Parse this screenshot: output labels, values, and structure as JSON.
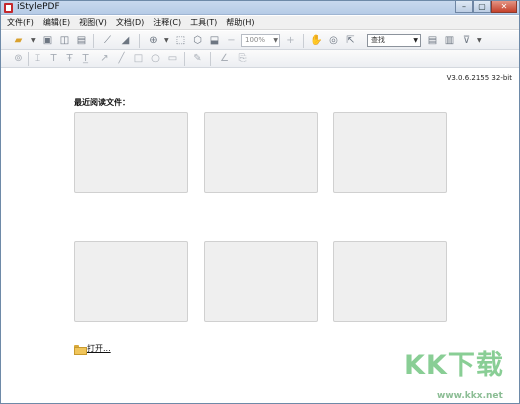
{
  "window": {
    "title": "iStylePDF",
    "controls": {
      "minimize": "–",
      "maximize": "▢",
      "close": "✕"
    }
  },
  "menu": [
    "文件(F)",
    "编辑(E)",
    "视图(V)",
    "文档(D)",
    "注释(C)",
    "工具(T)",
    "帮助(H)"
  ],
  "toolbar": {
    "zoom_value": "100%",
    "search_value": "查找"
  },
  "content": {
    "version": "V3.0.6.2155 32-bit",
    "recent_title": "最近阅读文件：",
    "open_label": "打开..."
  },
  "watermark": {
    "logo": "KK下载",
    "url": "www.kkx.net"
  }
}
